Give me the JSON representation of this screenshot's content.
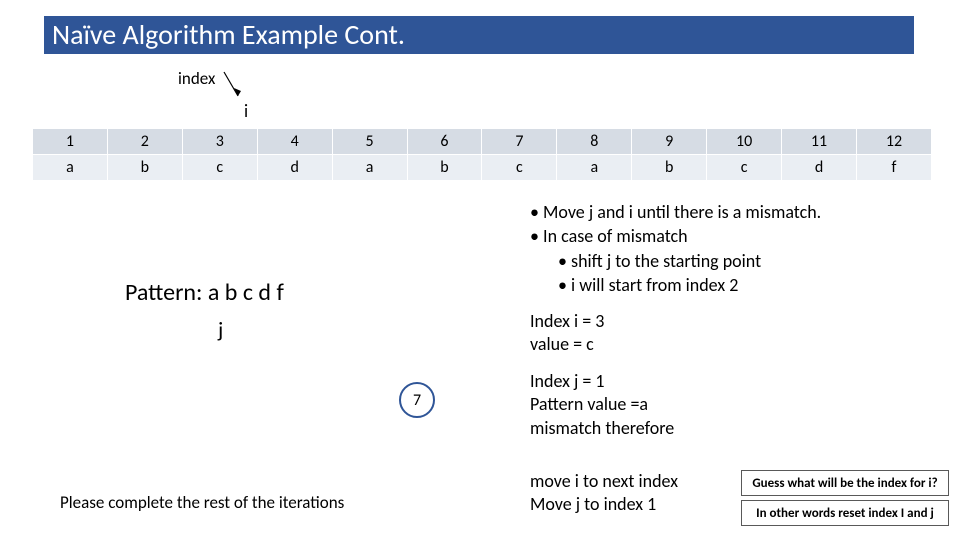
{
  "title": "Naïve Algorithm Example Cont.",
  "labels": {
    "index": "index",
    "i": "i",
    "j": "j",
    "pattern": "Pattern: a b c d f",
    "please": "Please complete the rest of the iterations"
  },
  "table": {
    "headers": [
      "1",
      "2",
      "3",
      "4",
      "5",
      "6",
      "7",
      "8",
      "9",
      "10",
      "11",
      "12"
    ],
    "values": [
      "a",
      "b",
      "c",
      "d",
      "a",
      "b",
      "c",
      "a",
      "b",
      "c",
      "d",
      "f"
    ]
  },
  "bullets": {
    "b1": "Move j and i until there is a mismatch.",
    "b2": "In case of mismatch",
    "b2a": "shift j to the starting point",
    "b2b": "i will start from index 2"
  },
  "state": {
    "i_line1": "Index i = 3",
    "i_line2": "value = c",
    "j_line1": "Index j = 1",
    "j_line2": "Pattern value =a",
    "j_line3": "mismatch therefore",
    "move_line1": "move i to next index",
    "move_line2": "Move j to index 1"
  },
  "badge": "7",
  "callouts": {
    "box1": "Guess what will be the index for i?",
    "box2": "In other words reset index I and j"
  }
}
